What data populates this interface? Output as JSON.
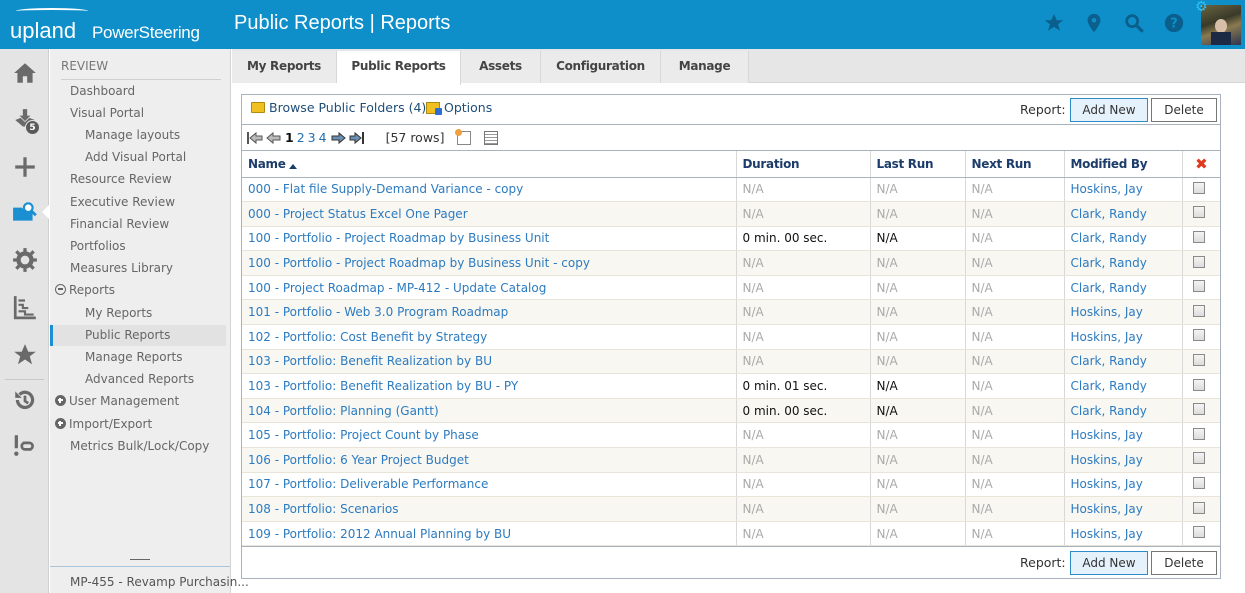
{
  "header": {
    "brand": "upland",
    "product": "PowerSteering",
    "title": "Public Reports | Reports",
    "icons": [
      "star-icon",
      "location-pin-icon",
      "search-icon",
      "help-icon"
    ],
    "avatar_alt": "user-avatar"
  },
  "rail": {
    "items": [
      {
        "name": "home-icon"
      },
      {
        "name": "inbox-icon",
        "badge": "5"
      },
      {
        "name": "plus-icon"
      },
      {
        "name": "review-icon",
        "active": true
      },
      {
        "name": "gear-icon"
      },
      {
        "name": "timeline-icon"
      },
      {
        "name": "favorites-star-icon"
      },
      {
        "name": "history-icon"
      },
      {
        "name": "link-alert-icon"
      }
    ]
  },
  "sidebar": {
    "section": "REVIEW",
    "items": [
      {
        "label": "Dashboard",
        "level": 1
      },
      {
        "label": "Visual Portal",
        "level": 1
      },
      {
        "label": "Manage layouts",
        "level": 2
      },
      {
        "label": "Add Visual Portal",
        "level": 2
      },
      {
        "label": "Resource Review",
        "level": 1
      },
      {
        "label": "Executive Review",
        "level": 1
      },
      {
        "label": "Financial Review",
        "level": 1
      },
      {
        "label": "Portfolios",
        "level": 1
      },
      {
        "label": "Measures Library",
        "level": 1
      },
      {
        "label": "Reports",
        "level": 0,
        "toggle": "minus"
      },
      {
        "label": "My Reports",
        "level": 2
      },
      {
        "label": "Public Reports",
        "level": 2,
        "selected": true
      },
      {
        "label": "Manage Reports",
        "level": 2
      },
      {
        "label": "Advanced Reports",
        "level": 2
      },
      {
        "label": "User Management",
        "level": 0,
        "toggle": "plus"
      },
      {
        "label": "Import/Export",
        "level": 0,
        "toggle": "plus"
      },
      {
        "label": "Metrics Bulk/Lock/Copy",
        "level": 1
      }
    ],
    "footer": "MP-455 - Revamp Purchasin..."
  },
  "tabs": [
    {
      "label": "My Reports"
    },
    {
      "label": "Public Reports",
      "active": true
    },
    {
      "label": "Assets"
    },
    {
      "label": "Configuration"
    },
    {
      "label": "Manage"
    }
  ],
  "toolbar": {
    "browse_label": "Browse Public Folders (4)",
    "options_label": "Options",
    "report_label": "Report:",
    "add_new": "Add New",
    "delete": "Delete"
  },
  "pager": {
    "pages": [
      "1",
      "2",
      "3",
      "4"
    ],
    "current": "1",
    "rows_text": "[57 rows]"
  },
  "table": {
    "columns": [
      "Name",
      "Duration",
      "Last Run",
      "Next Run",
      "Modified By"
    ],
    "sort_column": "Name",
    "sort_dir": "asc",
    "rows": [
      {
        "name": "000 - Flat file Supply-Demand Variance - copy",
        "duration": "N/A",
        "last_run": "N/A",
        "next_run": "N/A",
        "modified_by": "Hoskins, Jay"
      },
      {
        "name": "000 - Project Status Excel One Pager",
        "duration": "N/A",
        "last_run": "N/A",
        "next_run": "N/A",
        "modified_by": "Clark, Randy"
      },
      {
        "name": "100 - Portfolio - Project Roadmap by Business Unit",
        "duration": "0 min. 00 sec.",
        "last_run": "N/A",
        "next_run": "N/A",
        "modified_by": "Clark, Randy",
        "ran": true
      },
      {
        "name": "100 - Portfolio - Project Roadmap by Business Unit - copy",
        "duration": "N/A",
        "last_run": "N/A",
        "next_run": "N/A",
        "modified_by": "Clark, Randy"
      },
      {
        "name": "100 - Project Roadmap - MP-412 - Update Catalog",
        "duration": "N/A",
        "last_run": "N/A",
        "next_run": "N/A",
        "modified_by": "Clark, Randy"
      },
      {
        "name": "101 - Portfolio - Web 3.0 Program Roadmap",
        "duration": "N/A",
        "last_run": "N/A",
        "next_run": "N/A",
        "modified_by": "Hoskins, Jay"
      },
      {
        "name": "102 - Portfolio: Cost Benefit by Strategy",
        "duration": "N/A",
        "last_run": "N/A",
        "next_run": "N/A",
        "modified_by": "Hoskins, Jay"
      },
      {
        "name": "103 - Portfolio: Benefit Realization by BU",
        "duration": "N/A",
        "last_run": "N/A",
        "next_run": "N/A",
        "modified_by": "Clark, Randy"
      },
      {
        "name": "103 - Portfolio: Benefit Realization by BU - PY",
        "duration": "0 min. 01 sec.",
        "last_run": "N/A",
        "next_run": "N/A",
        "modified_by": "Clark, Randy",
        "ran": true
      },
      {
        "name": "104 - Portfolio: Planning (Gantt)",
        "duration": "0 min. 00 sec.",
        "last_run": "N/A",
        "next_run": "N/A",
        "modified_by": "Clark, Randy",
        "ran": true
      },
      {
        "name": "105 - Portfolio: Project Count by Phase",
        "duration": "N/A",
        "last_run": "N/A",
        "next_run": "N/A",
        "modified_by": "Hoskins, Jay"
      },
      {
        "name": "106 - Portfolio: 6 Year Project Budget",
        "duration": "N/A",
        "last_run": "N/A",
        "next_run": "N/A",
        "modified_by": "Hoskins, Jay"
      },
      {
        "name": "107 - Portfolio: Deliverable Performance",
        "duration": "N/A",
        "last_run": "N/A",
        "next_run": "N/A",
        "modified_by": "Hoskins, Jay"
      },
      {
        "name": "108 - Portfolio: Scenarios",
        "duration": "N/A",
        "last_run": "N/A",
        "next_run": "N/A",
        "modified_by": "Hoskins, Jay"
      },
      {
        "name": "109 - Portfolio: 2012 Annual Planning by BU",
        "duration": "N/A",
        "last_run": "N/A",
        "next_run": "N/A",
        "modified_by": "Hoskins, Jay"
      }
    ]
  },
  "colors": {
    "header_bg": "#0e8fca",
    "link": "#2c7bc0",
    "accent": "#1a8fd1",
    "delete_x": "#e03a1e"
  }
}
